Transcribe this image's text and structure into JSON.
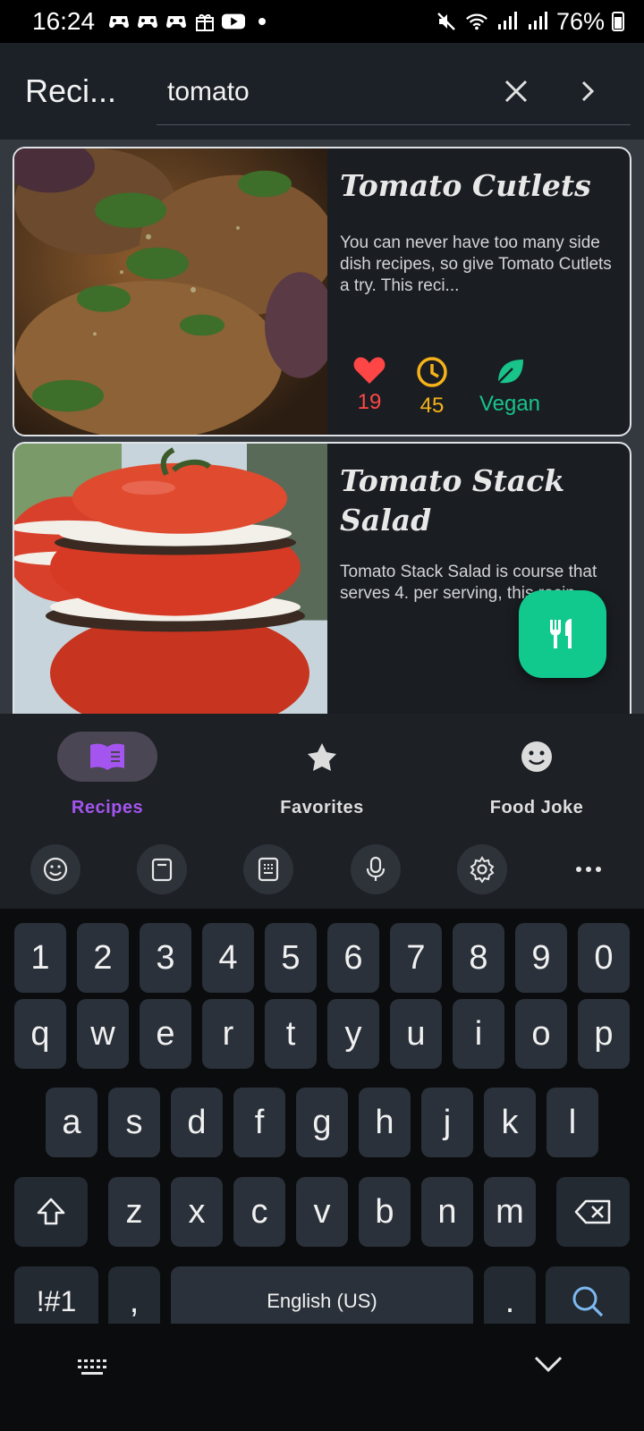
{
  "status_bar": {
    "time": "16:24",
    "battery": "76%",
    "notification_icons": [
      "game-icon",
      "game-icon",
      "game-icon",
      "gift-icon",
      "youtube-icon",
      "dot-icon"
    ],
    "right_icons": [
      "mute-icon",
      "wifi-icon",
      "signal-icon",
      "signal-icon"
    ]
  },
  "app_bar": {
    "title": "Reci...",
    "search": {
      "value": "tomato",
      "placeholder": ""
    }
  },
  "recipes": [
    {
      "title": "Tomato Cutlets",
      "description": "You can never have too many side dish recipes, so give Tomato Cutlets a try. This reci...",
      "likes": "19",
      "minutes": "45",
      "diet": "Vegan",
      "diet_active": true
    },
    {
      "title": "Tomato Stack Salad",
      "description": "Tomato Stack Salad is course that serves 4. per serving, this recip",
      "likes": "",
      "minutes": "",
      "diet": "",
      "diet_active": false
    }
  ],
  "colors": {
    "heart": "#ff4646",
    "clock": "#f6b21a",
    "vegan": "#18c48a",
    "accent": "#a455f0",
    "fab": "#12c98d"
  },
  "bottom_nav": [
    {
      "label": "Recipes",
      "icon": "book-icon",
      "active": true
    },
    {
      "label": "Favorites",
      "icon": "star-icon",
      "active": false
    },
    {
      "label": "Food Joke",
      "icon": "smiley-icon",
      "active": false
    }
  ],
  "keyboard": {
    "toolbar": [
      "emoji-icon",
      "clipboard-icon",
      "keypad-icon",
      "mic-icon",
      "settings-icon",
      "more-icon"
    ],
    "row_numbers": [
      "1",
      "2",
      "3",
      "4",
      "5",
      "6",
      "7",
      "8",
      "9",
      "0"
    ],
    "row1": [
      "q",
      "w",
      "e",
      "r",
      "t",
      "y",
      "u",
      "i",
      "o",
      "p"
    ],
    "row2": [
      "a",
      "s",
      "d",
      "f",
      "g",
      "h",
      "j",
      "k",
      "l"
    ],
    "row3": [
      "z",
      "x",
      "c",
      "v",
      "b",
      "n",
      "m"
    ],
    "symbols_key": "!#1",
    "comma_key": ",",
    "space_label": "English (US)",
    "period_key": "."
  }
}
